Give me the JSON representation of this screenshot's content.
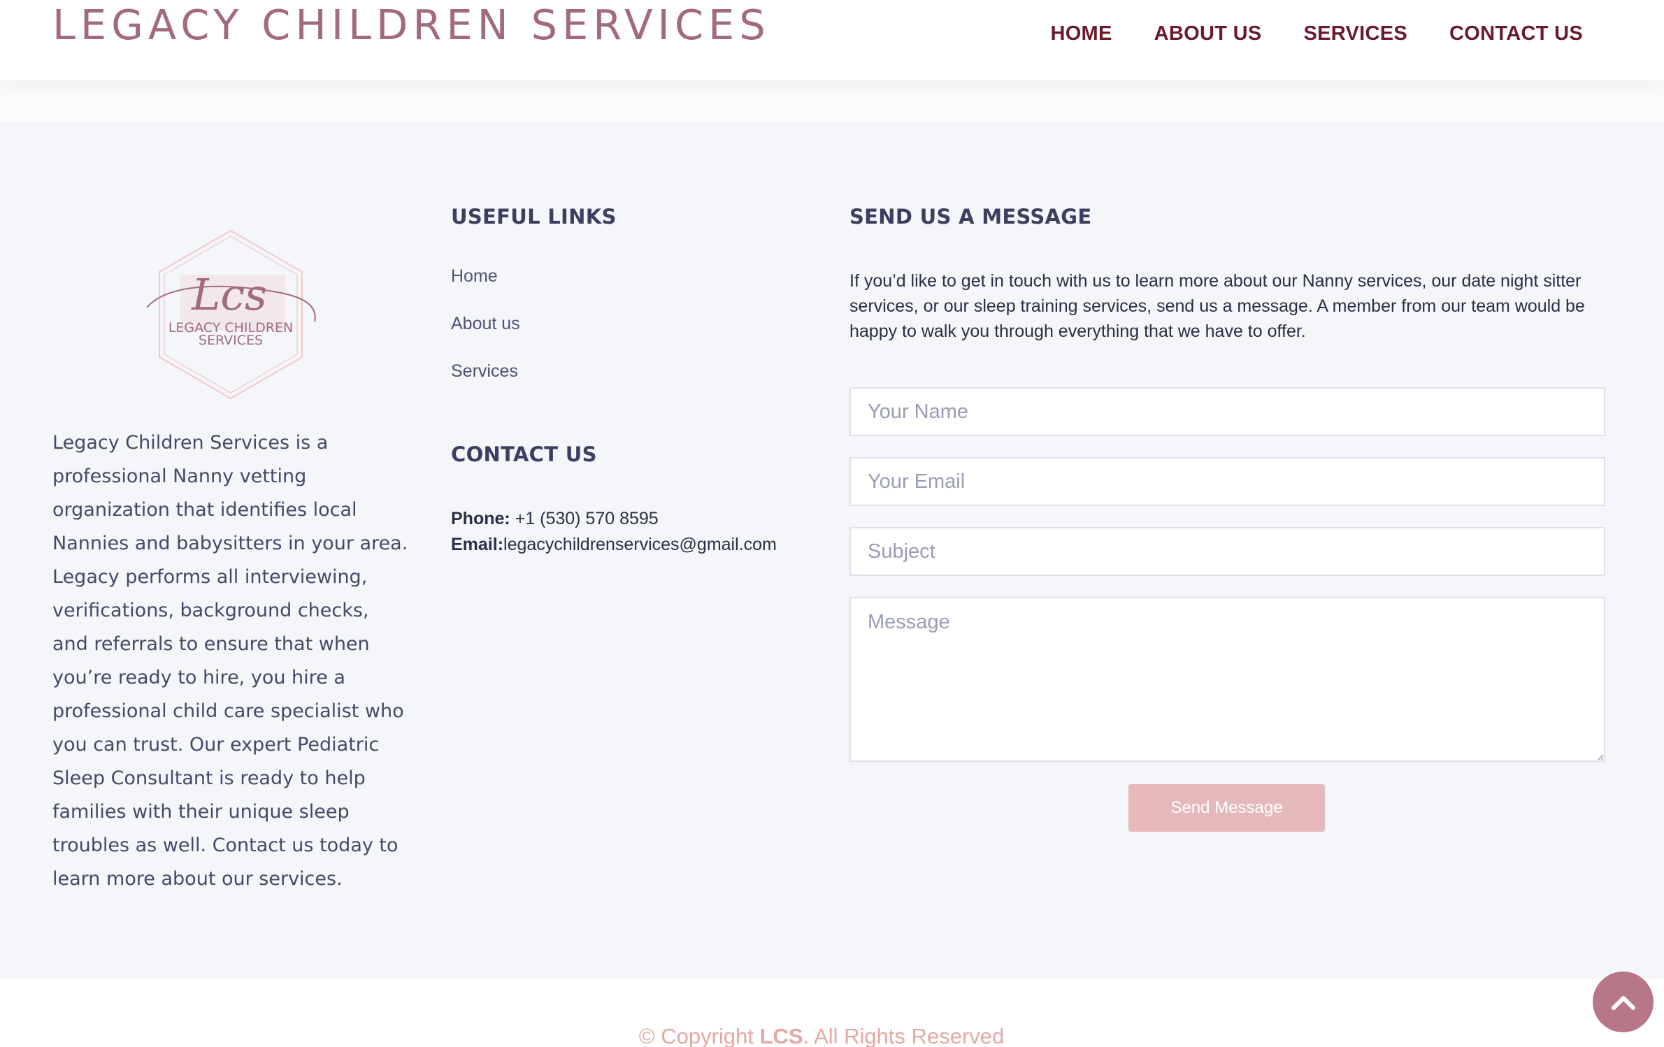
{
  "header": {
    "brand": "LEGACY CHILDREN SERVICES",
    "nav": [
      {
        "label": "HOME"
      },
      {
        "label": "ABOUT US"
      },
      {
        "label": "SERVICES"
      },
      {
        "label": "CONTACT US"
      }
    ]
  },
  "about": {
    "logo_monogram": "Lcs",
    "logo_text_line1": "LEGACY CHILDREN",
    "logo_text_line2": "SERVICES",
    "text": "Legacy Children Services is a professional Nanny vetting organization that identifies local Nannies and babysitters in your area. Legacy performs all interviewing, verifications, background checks, and referrals to ensure that when you’re ready to hire, you hire a professional child care specialist who you can trust. Our expert Pediatric Sleep Consultant is ready to help families with their unique sleep troubles as well. Contact us today to learn more about our services."
  },
  "useful_links": {
    "title": "USEFUL LINKS",
    "items": [
      {
        "label": "Home"
      },
      {
        "label": "About us"
      },
      {
        "label": "Services"
      }
    ]
  },
  "contact": {
    "title": "CONTACT US",
    "phone_label": "Phone:",
    "phone": "+1 (530) 570 8595",
    "email_label": "Email:",
    "email": "legacychildrenservices@gmail.com"
  },
  "message": {
    "title": "SEND US A MESSAGE",
    "intro": "If you’d like to get in touch with us to learn more about our Nanny services, our date night sitter services, or our sleep training services, send us a message. A member from our team would be happy to walk you through everything that we have to offer.",
    "name_placeholder": "Your Name",
    "email_placeholder": "Your Email",
    "subject_placeholder": "Subject",
    "message_placeholder": "Message",
    "send_label": "Send Message"
  },
  "footer": {
    "copyright_prefix": "© Copyright ",
    "copyright_brand": "LCS",
    "copyright_suffix": ". All Rights Reserved"
  },
  "colors": {
    "brand": "#a26a80",
    "nav": "#6b1a2a",
    "button": "#e5b9b9",
    "back_to_top": "#b87788"
  },
  "icons": {
    "back_to_top": "chevron-up-icon"
  }
}
